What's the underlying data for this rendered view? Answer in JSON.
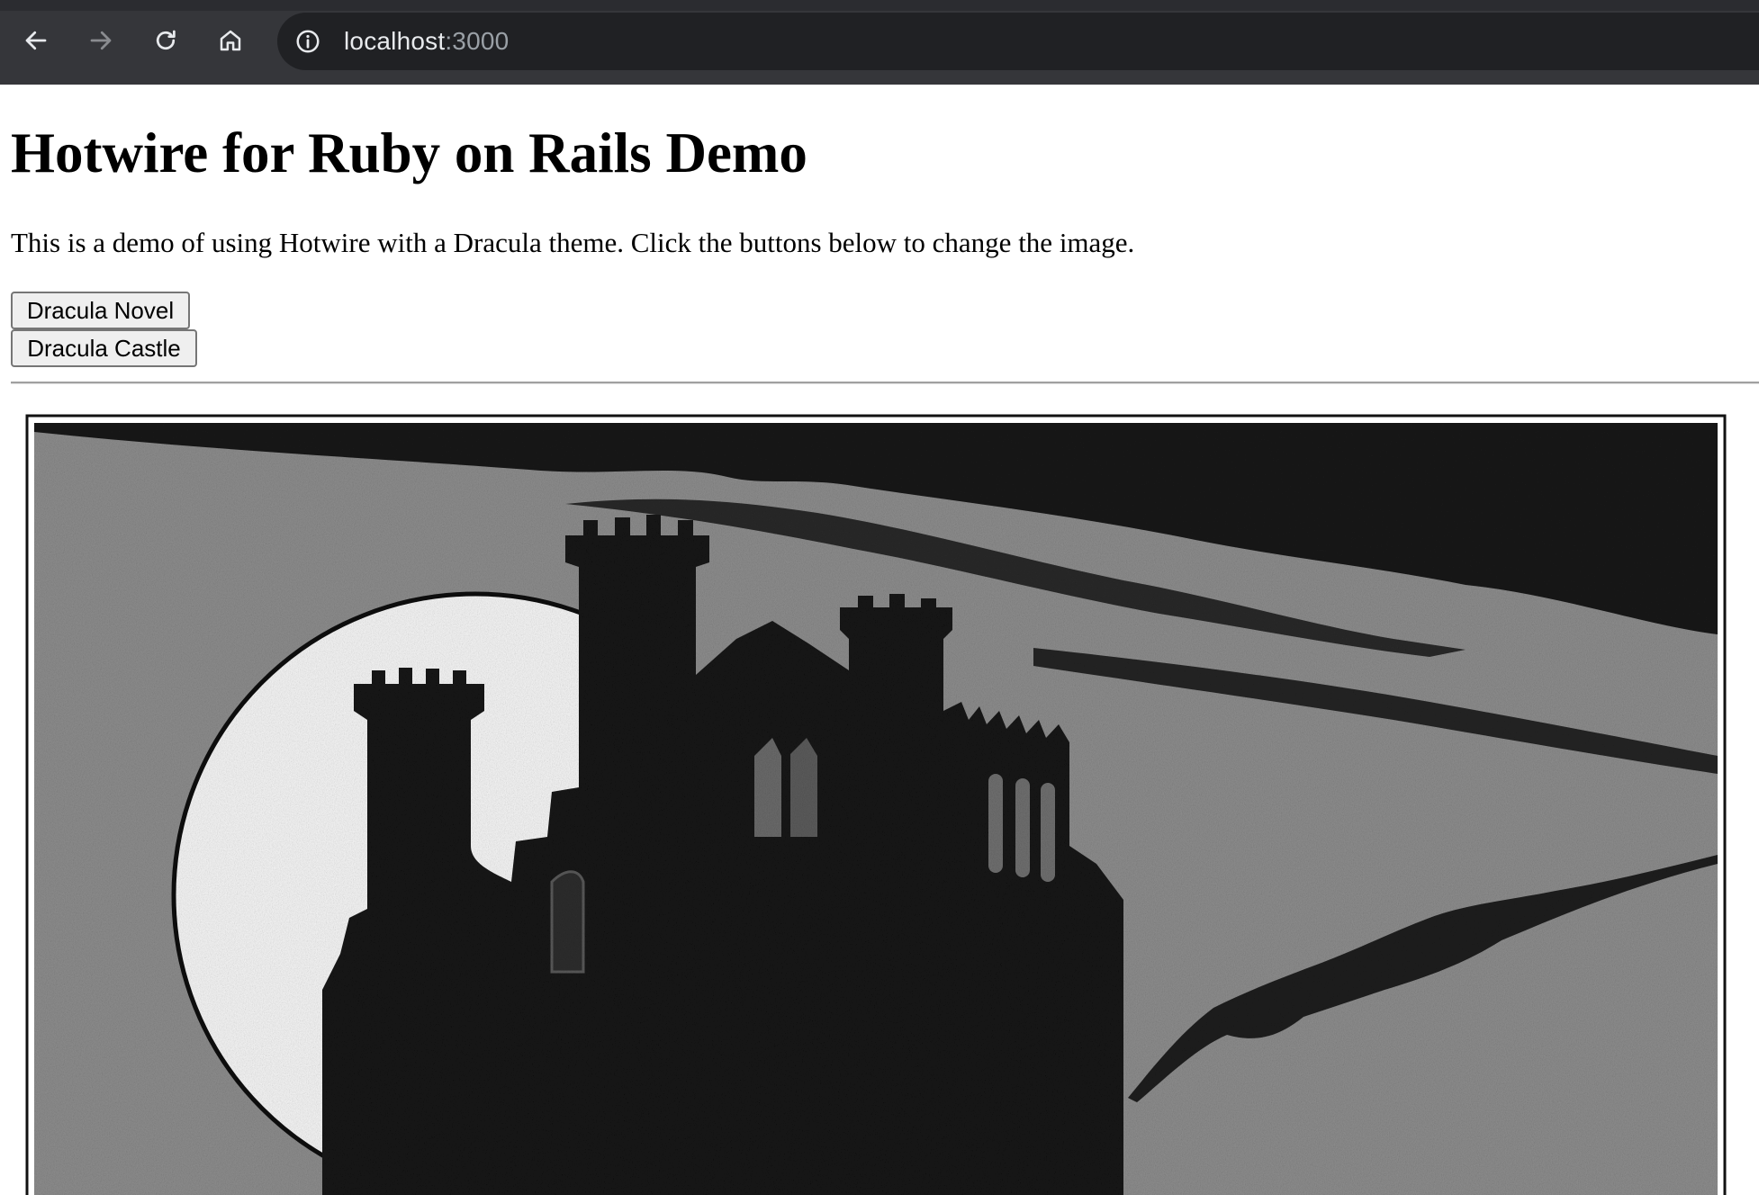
{
  "browser": {
    "url_host": "localhost",
    "url_port": ":3000",
    "toolbar_color": "#35363a",
    "omnibox_color": "#202124",
    "icons": [
      "back-arrow-icon",
      "forward-arrow-icon",
      "reload-icon",
      "home-icon",
      "info-icon"
    ]
  },
  "page": {
    "title": "Hotwire for Ruby on Rails Demo",
    "intro": "This is a demo of using Hotwire with a Dracula theme. Click the buttons below to change the image.",
    "buttons": [
      {
        "label": "Dracula Novel"
      },
      {
        "label": "Dracula Castle"
      }
    ]
  }
}
